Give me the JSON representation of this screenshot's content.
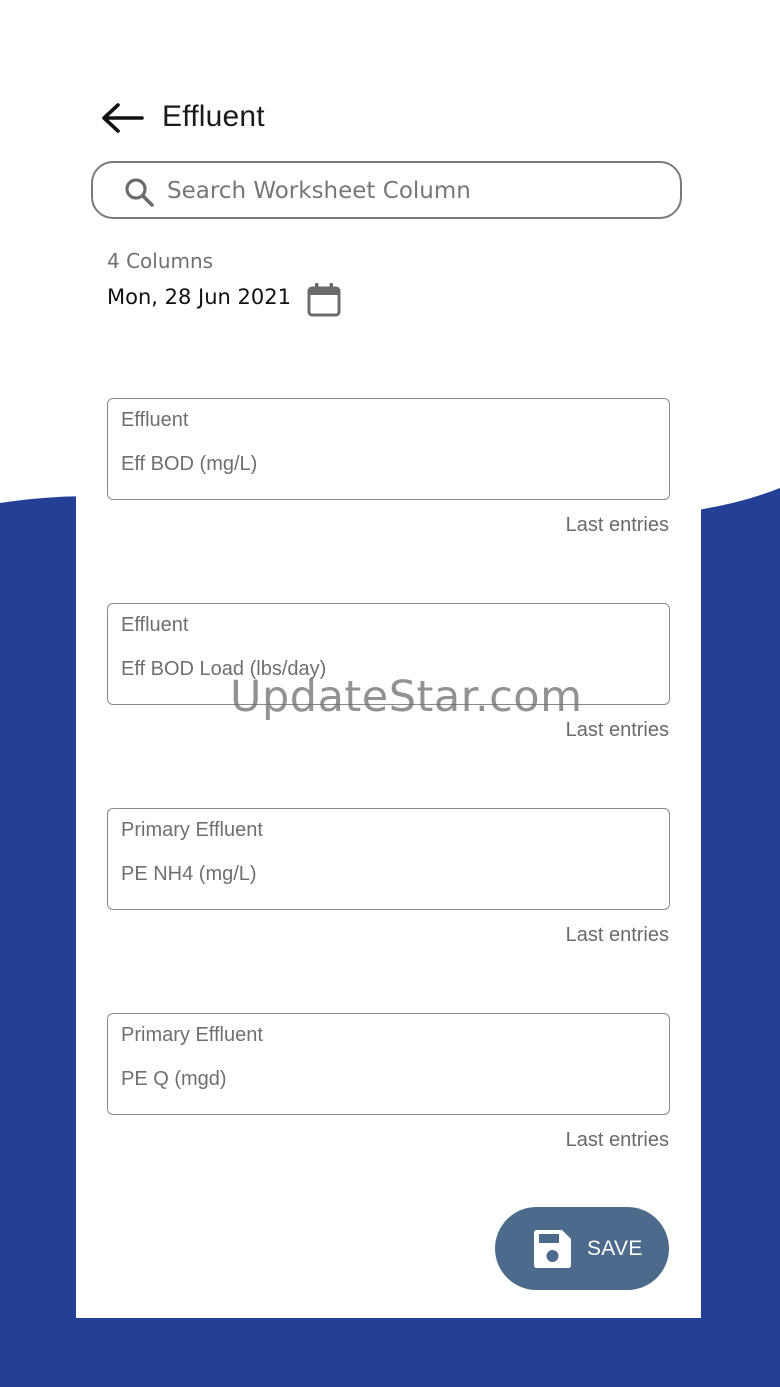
{
  "header": {
    "title": "Effluent"
  },
  "search": {
    "placeholder": "Search Worksheet Column",
    "value": ""
  },
  "summary": {
    "count_text": "4 Columns",
    "date_text": "Mon, 28 Jun 2021"
  },
  "fields": [
    {
      "group": "Effluent",
      "name": "Eff BOD (mg/L)",
      "link": "Last entries"
    },
    {
      "group": "Effluent",
      "name": "Eff BOD Load (lbs/day)",
      "link": "Last entries"
    },
    {
      "group": "Primary Effluent",
      "name": "PE NH4 (mg/L)",
      "link": "Last entries"
    },
    {
      "group": "Primary Effluent",
      "name": "PE Q (mgd)",
      "link": "Last entries"
    }
  ],
  "save_button": {
    "label": "SAVE"
  },
  "watermark": {
    "text": "UpdateStar.com"
  },
  "colors": {
    "background_blue": "#233f96",
    "save_button": "#4b6a8c"
  },
  "icons": {
    "back": "arrow-left-icon",
    "search": "search-icon",
    "calendar": "calendar-icon",
    "save": "floppy-disk-icon"
  }
}
